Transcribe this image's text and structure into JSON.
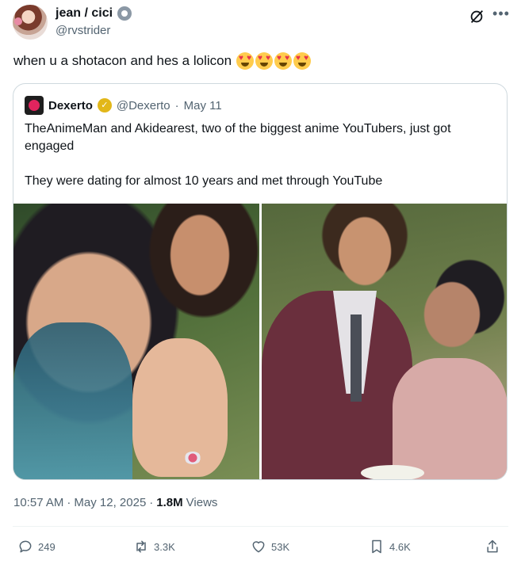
{
  "author": {
    "display_name": "jean / cici",
    "handle": "@rvstrider"
  },
  "tweet": {
    "text": "when u a shotacon and hes a lolicon",
    "emoji_count": 4
  },
  "quoted": {
    "name": "Dexerto",
    "handle": "@Dexerto",
    "separator": "·",
    "date": "May 11",
    "paragraphs": [
      "TheAnimeMan and Akidearest, two of the biggest anime YouTubers, just got engaged",
      "They were dating for almost 10 years and met through YouTube"
    ]
  },
  "meta": {
    "time": "10:57 AM",
    "date": "May 12, 2025",
    "separator": "·",
    "views_count": "1.8M",
    "views_label": "Views"
  },
  "actions": {
    "replies": "249",
    "reposts": "3.3K",
    "likes": "53K",
    "bookmarks": "4.6K"
  },
  "colors": {
    "text": "#0f1419",
    "secondary": "#536471",
    "border": "#cfd9de",
    "gold_badge": "#e2b719"
  },
  "icons": [
    "grok-icon",
    "more-icon",
    "reply-icon",
    "repost-icon",
    "like-icon",
    "bookmark-icon",
    "share-icon"
  ]
}
